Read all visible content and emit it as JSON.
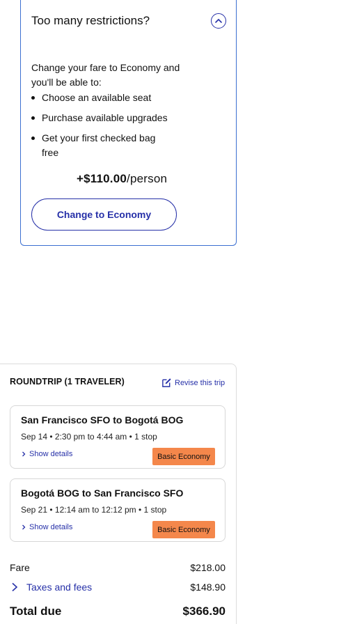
{
  "upsell": {
    "title": "Too many restrictions?",
    "lead": "Change your fare to Economy and you'll be able to:",
    "benefits": [
      "Choose an available seat",
      "Purchase available upgrades",
      "Get your first checked bag free"
    ],
    "price": "+$110.00",
    "price_unit": "/person",
    "button_label": "Change to Economy",
    "collapse_icon": "chevron-up-circle-icon"
  },
  "summary": {
    "heading": "ROUNDTRIP (1 TRAVELER)",
    "revise_label": "Revise this trip",
    "flights": [
      {
        "route": "San Francisco SFO to Bogotá BOG",
        "times": "Sep 14 • 2:30 pm to 4:44 am • 1 stop",
        "details_label": "Show details",
        "badge": "Basic Economy"
      },
      {
        "route": "Bogotá BOG to San Francisco SFO",
        "times": "Sep 21 • 12:14 am to 12:12 pm • 1 stop",
        "details_label": "Show details",
        "badge": "Basic Economy"
      }
    ],
    "fare_label": "Fare",
    "fare_amount": "$218.00",
    "taxes_label": "Taxes and fees",
    "taxes_amount": "$148.90",
    "total_label": "Total due",
    "total_amount": "$366.90"
  },
  "colors": {
    "link": "#2630a8",
    "card_border": "#3b6fd1",
    "badge": "#f4874b"
  }
}
